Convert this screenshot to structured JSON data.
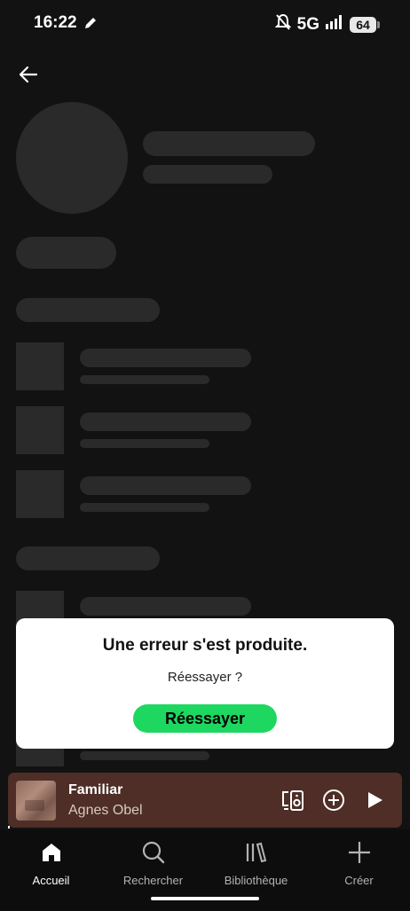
{
  "status_bar": {
    "time": "16:22",
    "network": "5G",
    "battery": "64"
  },
  "dialog": {
    "title": "Une erreur s'est produite.",
    "subtitle": "Réessayer ?",
    "button_label": "Réessayer"
  },
  "mini_player": {
    "title": "Familiar",
    "artist": "Agnes Obel"
  },
  "nav": {
    "items": [
      {
        "label": "Accueil",
        "icon": "home-icon",
        "active": true
      },
      {
        "label": "Rechercher",
        "icon": "search-icon",
        "active": false
      },
      {
        "label": "Bibliothèque",
        "icon": "library-icon",
        "active": false
      },
      {
        "label": "Créer",
        "icon": "plus-icon",
        "active": false
      }
    ]
  },
  "colors": {
    "accent": "#1ed760",
    "background": "#121212",
    "skeleton": "#2a2a2a",
    "mini_player_bg": "#4e2e26"
  }
}
